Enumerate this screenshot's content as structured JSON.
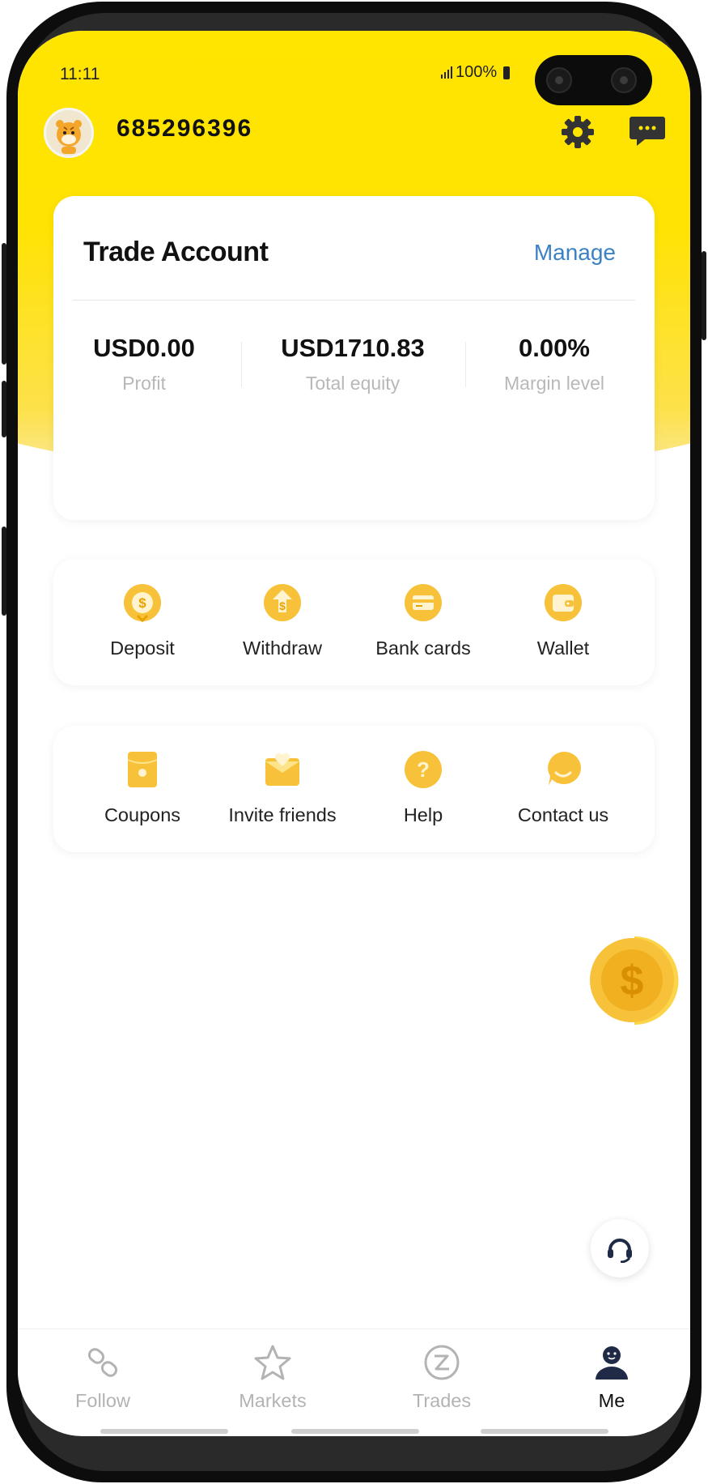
{
  "status_bar": {
    "time": "11:11",
    "battery": "100%"
  },
  "header": {
    "user_id": "685296396"
  },
  "trade_account": {
    "title": "Trade Account",
    "manage_label": "Manage",
    "stats": [
      {
        "value": "USD0.00",
        "label": "Profit"
      },
      {
        "value": "USD1710.83",
        "label": "Total equity"
      },
      {
        "value": "0.00%",
        "label": "Margin level"
      }
    ]
  },
  "funds_menu": [
    {
      "label": "Deposit",
      "icon": "deposit-icon"
    },
    {
      "label": "Withdraw",
      "icon": "withdraw-icon"
    },
    {
      "label": "Bank cards",
      "icon": "bank-card-icon"
    },
    {
      "label": "Wallet",
      "icon": "wallet-icon"
    }
  ],
  "service_menu": [
    {
      "label": "Coupons",
      "icon": "coupon-icon"
    },
    {
      "label": "Invite friends",
      "icon": "invite-icon"
    },
    {
      "label": "Help",
      "icon": "help-icon"
    },
    {
      "label": "Contact us",
      "icon": "chat-bubble-icon"
    }
  ],
  "bottom_nav": [
    {
      "label": "Follow",
      "icon": "link-icon",
      "active": false
    },
    {
      "label": "Markets",
      "icon": "star-icon",
      "active": false
    },
    {
      "label": "Trades",
      "icon": "trades-icon",
      "active": false
    },
    {
      "label": "Me",
      "icon": "person-icon",
      "active": true
    }
  ],
  "colors": {
    "header_yellow": "#ffe500",
    "icon_gold": "#f7c23a",
    "link_blue": "#3b82c4",
    "muted_gray": "#b8b8b8"
  }
}
